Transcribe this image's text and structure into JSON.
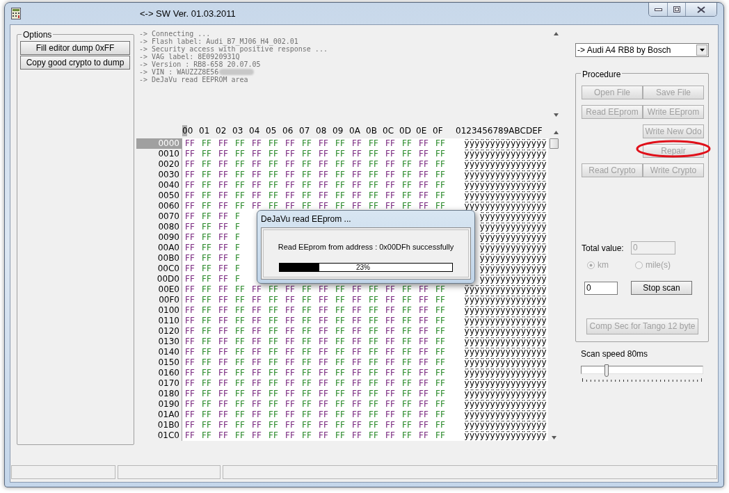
{
  "window": {
    "title": "<-> SW Ver. 01.03.2011"
  },
  "options": {
    "title": "Options",
    "buttons": [
      "Fill editor dump 0xFF",
      "Copy good crypto to dump"
    ]
  },
  "log": {
    "lines": [
      {
        "text": "-> Connecting ...",
        "redacted": false
      },
      {
        "text": "-> Flash label: Audi_B7_MJ06_H4_002.01",
        "redacted": false
      },
      {
        "text": "-> Security access with positive response ...",
        "redacted": false
      },
      {
        "text": "-> VAG label: 8E0920931Q",
        "redacted": false
      },
      {
        "text": "-> Version : RB8-658 20.07.05",
        "redacted": false
      },
      {
        "text": "-> VIN : WAUZZZ8E56",
        "redacted": true
      },
      {
        "text": "-> DeJaVu read EEPROM area",
        "redacted": false
      }
    ]
  },
  "hex": {
    "columns": [
      "00",
      "01",
      "02",
      "03",
      "04",
      "05",
      "06",
      "07",
      "08",
      "09",
      "0A",
      "0B",
      "0C",
      "0D",
      "0E",
      "0F"
    ],
    "ascii_header": "0123456789ABCDEF",
    "rows": [
      {
        "address": "0000",
        "selected": true,
        "bytes": [
          "FF",
          "FF",
          "FF",
          "FF",
          "FF",
          "FF",
          "FF",
          "FF",
          "FF",
          "FF",
          "FF",
          "FF",
          "FF",
          "FF",
          "FF",
          "FF"
        ],
        "ascii": "ÿÿÿÿÿÿÿÿÿÿÿÿÿÿÿÿ"
      },
      {
        "address": "0010",
        "selected": false,
        "bytes": [
          "FF",
          "FF",
          "FF",
          "FF",
          "FF",
          "FF",
          "FF",
          "FF",
          "FF",
          "FF",
          "FF",
          "FF",
          "FF",
          "FF",
          "FF",
          "FF"
        ],
        "ascii": "ÿÿÿÿÿÿÿÿÿÿÿÿÿÿÿÿ"
      },
      {
        "address": "0020",
        "selected": false,
        "bytes": [
          "FF",
          "FF",
          "FF",
          "FF",
          "FF",
          "FF",
          "FF",
          "FF",
          "FF",
          "FF",
          "FF",
          "FF",
          "FF",
          "FF",
          "FF",
          "FF"
        ],
        "ascii": "ÿÿÿÿÿÿÿÿÿÿÿÿÿÿÿÿ"
      },
      {
        "address": "0030",
        "selected": false,
        "bytes": [
          "FF",
          "FF",
          "FF",
          "FF",
          "FF",
          "FF",
          "FF",
          "FF",
          "FF",
          "FF",
          "FF",
          "FF",
          "FF",
          "FF",
          "FF",
          "FF"
        ],
        "ascii": "ÿÿÿÿÿÿÿÿÿÿÿÿÿÿÿÿ"
      },
      {
        "address": "0040",
        "selected": false,
        "bytes": [
          "FF",
          "FF",
          "FF",
          "FF",
          "FF",
          "FF",
          "FF",
          "FF",
          "FF",
          "FF",
          "FF",
          "FF",
          "FF",
          "FF",
          "FF",
          "FF"
        ],
        "ascii": "ÿÿÿÿÿÿÿÿÿÿÿÿÿÿÿÿ"
      },
      {
        "address": "0050",
        "selected": false,
        "bytes": [
          "FF",
          "FF",
          "FF",
          "FF",
          "FF",
          "FF",
          "FF",
          "FF",
          "FF",
          "FF",
          "FF",
          "FF",
          "FF",
          "FF",
          "FF",
          "FF"
        ],
        "ascii": "ÿÿÿÿÿÿÿÿÿÿÿÿÿÿÿÿ"
      },
      {
        "address": "0060",
        "selected": false,
        "bytes": [
          "FF",
          "FF",
          "FF",
          "FF",
          "FF",
          "FF",
          "FF",
          "FF",
          "FF",
          "FF",
          "FF",
          "FF",
          "FF",
          "FF",
          "FF",
          "FF"
        ],
        "ascii": "ÿÿÿÿÿÿÿÿÿÿÿÿÿÿÿÿ"
      },
      {
        "address": "0070",
        "selected": false,
        "bytes": [
          "FF",
          "FF",
          "FF",
          "F"
        ],
        "ascii": "ÿÿÿÿÿÿÿÿÿÿÿÿÿ"
      },
      {
        "address": "0080",
        "selected": false,
        "bytes": [
          "FF",
          "FF",
          "FF",
          "F"
        ],
        "ascii": "ÿÿÿÿÿÿÿÿÿÿÿÿÿ"
      },
      {
        "address": "0090",
        "selected": false,
        "bytes": [
          "FF",
          "FF",
          "FF",
          "F"
        ],
        "ascii": "ÿÿÿÿÿÿÿÿÿÿÿÿÿ"
      },
      {
        "address": "00A0",
        "selected": false,
        "bytes": [
          "FF",
          "FF",
          "FF",
          "F"
        ],
        "ascii": "ÿÿÿÿÿÿÿÿÿÿÿÿÿ"
      },
      {
        "address": "00B0",
        "selected": false,
        "bytes": [
          "FF",
          "FF",
          "FF",
          "F"
        ],
        "ascii": "ÿÿÿÿÿÿÿÿÿÿÿÿÿ"
      },
      {
        "address": "00C0",
        "selected": false,
        "bytes": [
          "FF",
          "FF",
          "FF",
          "F"
        ],
        "ascii": "ÿÿÿÿÿÿÿÿÿÿÿÿÿ"
      },
      {
        "address": "00D0",
        "selected": false,
        "bytes": [
          "FF",
          "FF",
          "FF",
          "F"
        ],
        "ascii": "ÿÿÿÿÿÿÿÿÿÿÿÿÿ"
      },
      {
        "address": "00E0",
        "selected": false,
        "bytes": [
          "FF",
          "FF",
          "FF",
          "FF",
          "FF",
          "FF",
          "FF",
          "FF",
          "FF",
          "FF",
          "FF",
          "FF",
          "FF",
          "FF",
          "FF",
          "FF"
        ],
        "ascii": "ÿÿÿÿÿÿÿÿÿÿÿÿÿÿÿÿ"
      },
      {
        "address": "00F0",
        "selected": false,
        "bytes": [
          "FF",
          "FF",
          "FF",
          "FF",
          "FF",
          "FF",
          "FF",
          "FF",
          "FF",
          "FF",
          "FF",
          "FF",
          "FF",
          "FF",
          "FF",
          "FF"
        ],
        "ascii": "ÿÿÿÿÿÿÿÿÿÿÿÿÿÿÿÿ"
      },
      {
        "address": "0100",
        "selected": false,
        "bytes": [
          "FF",
          "FF",
          "FF",
          "FF",
          "FF",
          "FF",
          "FF",
          "FF",
          "FF",
          "FF",
          "FF",
          "FF",
          "FF",
          "FF",
          "FF",
          "FF"
        ],
        "ascii": "ÿÿÿÿÿÿÿÿÿÿÿÿÿÿÿÿ"
      },
      {
        "address": "0110",
        "selected": false,
        "bytes": [
          "FF",
          "FF",
          "FF",
          "FF",
          "FF",
          "FF",
          "FF",
          "FF",
          "FF",
          "FF",
          "FF",
          "FF",
          "FF",
          "FF",
          "FF",
          "FF"
        ],
        "ascii": "ÿÿÿÿÿÿÿÿÿÿÿÿÿÿÿÿ"
      },
      {
        "address": "0120",
        "selected": false,
        "bytes": [
          "FF",
          "FF",
          "FF",
          "FF",
          "FF",
          "FF",
          "FF",
          "FF",
          "FF",
          "FF",
          "FF",
          "FF",
          "FF",
          "FF",
          "FF",
          "FF"
        ],
        "ascii": "ÿÿÿÿÿÿÿÿÿÿÿÿÿÿÿÿ"
      },
      {
        "address": "0130",
        "selected": false,
        "bytes": [
          "FF",
          "FF",
          "FF",
          "FF",
          "FF",
          "FF",
          "FF",
          "FF",
          "FF",
          "FF",
          "FF",
          "FF",
          "FF",
          "FF",
          "FF",
          "FF"
        ],
        "ascii": "ÿÿÿÿÿÿÿÿÿÿÿÿÿÿÿÿ"
      },
      {
        "address": "0140",
        "selected": false,
        "bytes": [
          "FF",
          "FF",
          "FF",
          "FF",
          "FF",
          "FF",
          "FF",
          "FF",
          "FF",
          "FF",
          "FF",
          "FF",
          "FF",
          "FF",
          "FF",
          "FF"
        ],
        "ascii": "ÿÿÿÿÿÿÿÿÿÿÿÿÿÿÿÿ"
      },
      {
        "address": "0150",
        "selected": false,
        "bytes": [
          "FF",
          "FF",
          "FF",
          "FF",
          "FF",
          "FF",
          "FF",
          "FF",
          "FF",
          "FF",
          "FF",
          "FF",
          "FF",
          "FF",
          "FF",
          "FF"
        ],
        "ascii": "ÿÿÿÿÿÿÿÿÿÿÿÿÿÿÿÿ"
      },
      {
        "address": "0160",
        "selected": false,
        "bytes": [
          "FF",
          "FF",
          "FF",
          "FF",
          "FF",
          "FF",
          "FF",
          "FF",
          "FF",
          "FF",
          "FF",
          "FF",
          "FF",
          "FF",
          "FF",
          "FF"
        ],
        "ascii": "ÿÿÿÿÿÿÿÿÿÿÿÿÿÿÿÿ"
      },
      {
        "address": "0170",
        "selected": false,
        "bytes": [
          "FF",
          "FF",
          "FF",
          "FF",
          "FF",
          "FF",
          "FF",
          "FF",
          "FF",
          "FF",
          "FF",
          "FF",
          "FF",
          "FF",
          "FF",
          "FF"
        ],
        "ascii": "ÿÿÿÿÿÿÿÿÿÿÿÿÿÿÿÿ"
      },
      {
        "address": "0180",
        "selected": false,
        "bytes": [
          "FF",
          "FF",
          "FF",
          "FF",
          "FF",
          "FF",
          "FF",
          "FF",
          "FF",
          "FF",
          "FF",
          "FF",
          "FF",
          "FF",
          "FF",
          "FF"
        ],
        "ascii": "ÿÿÿÿÿÿÿÿÿÿÿÿÿÿÿÿ"
      },
      {
        "address": "0190",
        "selected": false,
        "bytes": [
          "FF",
          "FF",
          "FF",
          "FF",
          "FF",
          "FF",
          "FF",
          "FF",
          "FF",
          "FF",
          "FF",
          "FF",
          "FF",
          "FF",
          "FF",
          "FF"
        ],
        "ascii": "ÿÿÿÿÿÿÿÿÿÿÿÿÿÿÿÿ"
      },
      {
        "address": "01A0",
        "selected": false,
        "bytes": [
          "FF",
          "FF",
          "FF",
          "FF",
          "FF",
          "FF",
          "FF",
          "FF",
          "FF",
          "FF",
          "FF",
          "FF",
          "FF",
          "FF",
          "FF",
          "FF"
        ],
        "ascii": "ÿÿÿÿÿÿÿÿÿÿÿÿÿÿÿÿ"
      },
      {
        "address": "01B0",
        "selected": false,
        "bytes": [
          "FF",
          "FF",
          "FF",
          "FF",
          "FF",
          "FF",
          "FF",
          "FF",
          "FF",
          "FF",
          "FF",
          "FF",
          "FF",
          "FF",
          "FF",
          "FF"
        ],
        "ascii": "ÿÿÿÿÿÿÿÿÿÿÿÿÿÿÿÿ"
      },
      {
        "address": "01C0",
        "selected": false,
        "bytes": [
          "FF",
          "FF",
          "FF",
          "FF",
          "FF",
          "FF",
          "FF",
          "FF",
          "FF",
          "FF",
          "FF",
          "FF",
          "FF",
          "FF",
          "FF",
          "FF"
        ],
        "ascii": "ÿÿÿÿÿÿÿÿÿÿÿÿÿÿÿÿ"
      }
    ]
  },
  "dialog": {
    "title": "DeJaVu read EEprom ...",
    "message": "Read EEprom from address : 0x00DFh successfully",
    "progress": {
      "level": 0.23,
      "reading": "23%"
    }
  },
  "model_select": {
    "value": "-> Audi A4 RB8 by Bosch"
  },
  "procedure": {
    "title": "Procedure",
    "rows": [
      {
        "left": {
          "label": "Open File",
          "disabled": true
        },
        "right": {
          "label": "Save File",
          "disabled": true
        }
      },
      {
        "left": {
          "label": "Read EEprom",
          "disabled": true
        },
        "right": {
          "label": "Write EEprom",
          "disabled": true
        }
      },
      {
        "right": {
          "label": "Write New Odo",
          "disabled": true
        }
      },
      {
        "right": {
          "label": "Repair",
          "disabled": true,
          "circled": true
        }
      },
      {
        "left": {
          "label": "Read Crypto",
          "disabled": true
        },
        "right": {
          "label": "Write Crypto",
          "disabled": true
        }
      }
    ],
    "total_label": "Total value:",
    "total_field": {
      "value": "0",
      "disabled": true
    },
    "units": [
      {
        "label": "km",
        "selected": true,
        "disabled": true
      },
      {
        "label": "mile(s)",
        "selected": false,
        "disabled": true
      }
    ],
    "scan_field": {
      "value": "0"
    },
    "stop_button": {
      "label": "Stop scan",
      "disabled": false
    },
    "comp_button": {
      "label": "Comp Sec for Tango 12 byte",
      "disabled": true
    }
  },
  "scan_speed": {
    "label": "Scan speed 80ms",
    "level": 0.2
  }
}
